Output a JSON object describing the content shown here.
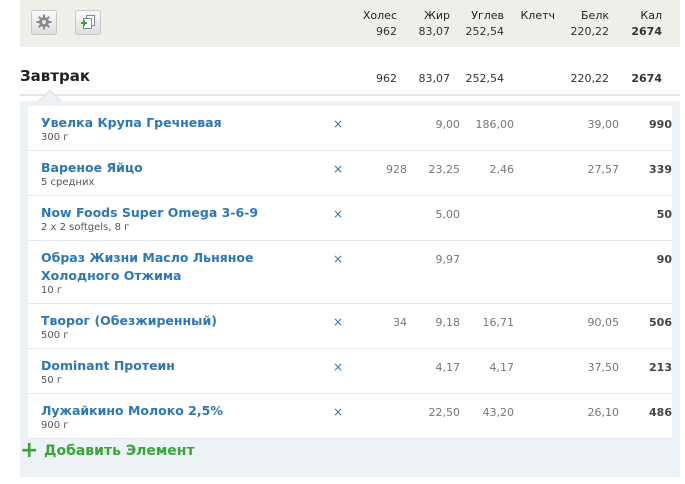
{
  "totals": {
    "headers": {
      "cholesterol": "Холес",
      "fat": "Жир",
      "carbs": "Углев",
      "fiber": "Клетч",
      "protein": "Белк",
      "calories": "Кал"
    },
    "values": {
      "cholesterol": "962",
      "fat": "83,07",
      "carbs": "252,54",
      "fiber": "",
      "protein": "220,22",
      "calories": "2674"
    }
  },
  "toolbar": {
    "settings_icon": "gear-icon",
    "copy_icon": "copy-add-icon"
  },
  "meal": {
    "title": "Завтрак",
    "values": {
      "cholesterol": "962",
      "fat": "83,07",
      "carbs": "252,54",
      "fiber": "",
      "protein": "220,22",
      "calories": "2674"
    }
  },
  "items": [
    {
      "name": "Увелка Крупа Гречневая",
      "portion": "300 г",
      "delete": "×",
      "cholesterol": "",
      "fat": "9,00",
      "carbs": "186,00",
      "fiber": "",
      "protein": "39,00",
      "calories": "990"
    },
    {
      "name": "Вареное Яйцо",
      "portion": "5 средних",
      "delete": "×",
      "cholesterol": "928",
      "fat": "23,25",
      "carbs": "2,46",
      "fiber": "",
      "protein": "27,57",
      "calories": "339"
    },
    {
      "name": "Now Foods Super Omega 3-6-9",
      "portion": "2 x 2 softgels, 8 г",
      "delete": "×",
      "cholesterol": "",
      "fat": "5,00",
      "carbs": "",
      "fiber": "",
      "protein": "",
      "calories": "50"
    },
    {
      "name": "Образ Жизни Масло Льняное Холодного Отжима",
      "portion": "10 г",
      "delete": "×",
      "cholesterol": "",
      "fat": "9,97",
      "carbs": "",
      "fiber": "",
      "protein": "",
      "calories": "90"
    },
    {
      "name": "Творог (Обезжиренный)",
      "portion": "500 г",
      "delete": "×",
      "cholesterol": "34",
      "fat": "9,18",
      "carbs": "16,71",
      "fiber": "",
      "protein": "90,05",
      "calories": "506"
    },
    {
      "name": "Dominant Протеин",
      "portion": "50 г",
      "delete": "×",
      "cholesterol": "",
      "fat": "4,17",
      "carbs": "4,17",
      "fiber": "",
      "protein": "37,50",
      "calories": "213"
    },
    {
      "name": "Лужайкино Молоко 2,5%",
      "portion": "900 г",
      "delete": "×",
      "cholesterol": "",
      "fat": "22,50",
      "carbs": "43,20",
      "fiber": "",
      "protein": "26,10",
      "calories": "486"
    }
  ],
  "add_item": {
    "plus": "+",
    "label": "Добавить Элемент"
  },
  "colors": {
    "link": "#2d77b5",
    "add": "#3aa43a",
    "panel": "#ecf2f5",
    "bar": "#efefe9"
  }
}
